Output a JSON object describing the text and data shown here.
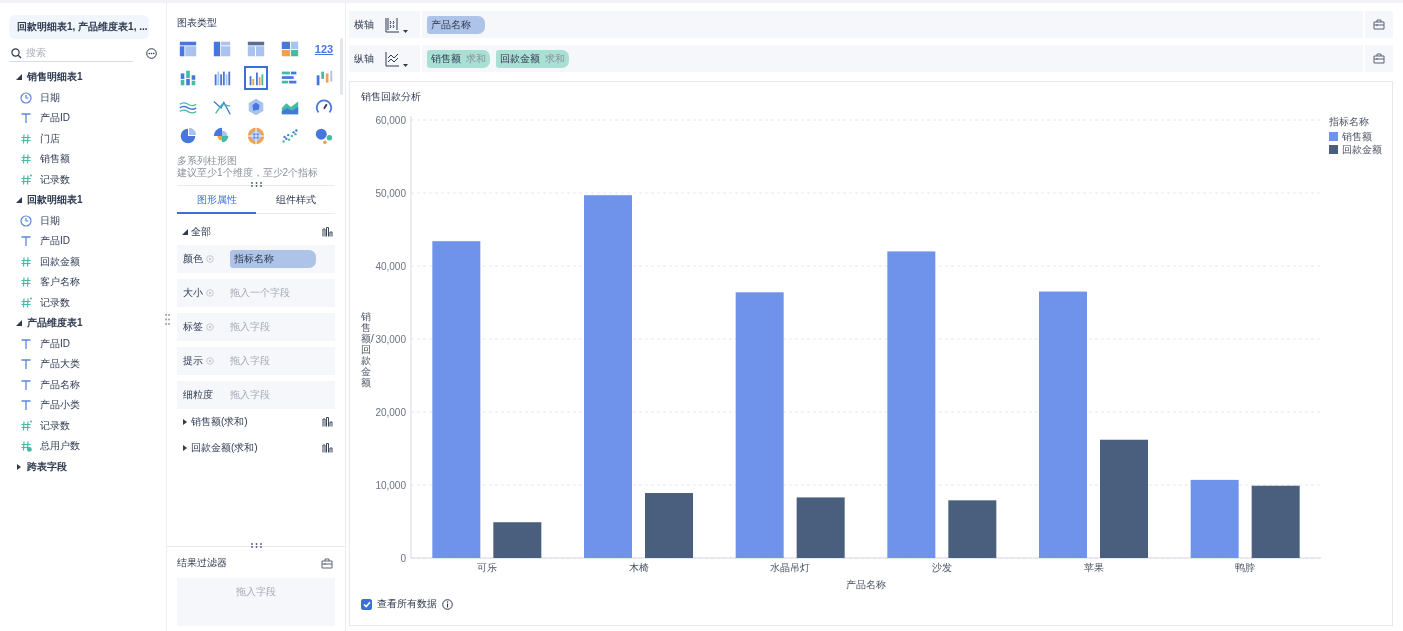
{
  "data_source": {
    "label": "回款明细表1, 产品维度表1, ..."
  },
  "search": {
    "placeholder": "搜索"
  },
  "field_tree": [
    {
      "label": "销售明细表1",
      "expanded": true,
      "children": [
        {
          "label": "日期",
          "kind": "date"
        },
        {
          "label": "产品ID",
          "kind": "text"
        },
        {
          "label": "门店",
          "kind": "number"
        },
        {
          "label": "销售额",
          "kind": "number"
        },
        {
          "label": "记录数",
          "kind": "count"
        }
      ]
    },
    {
      "label": "回款明细表1",
      "expanded": true,
      "children": [
        {
          "label": "日期",
          "kind": "date"
        },
        {
          "label": "产品ID",
          "kind": "text"
        },
        {
          "label": "回款金额",
          "kind": "number"
        },
        {
          "label": "客户名称",
          "kind": "number"
        },
        {
          "label": "记录数",
          "kind": "count"
        }
      ]
    },
    {
      "label": "产品维度表1",
      "expanded": true,
      "children": [
        {
          "label": "产品ID",
          "kind": "text"
        },
        {
          "label": "产品大类",
          "kind": "text"
        },
        {
          "label": "产品名称",
          "kind": "text"
        },
        {
          "label": "产品小类",
          "kind": "text"
        },
        {
          "label": "记录数",
          "kind": "count"
        },
        {
          "label": "总用户数",
          "kind": "calculated"
        }
      ]
    },
    {
      "label": "跨表字段",
      "expanded": false
    }
  ],
  "chart_types": {
    "title": "图表类型",
    "items": [
      {
        "kind": "table",
        "selected": false
      },
      {
        "kind": "crosstab",
        "selected": false
      },
      {
        "kind": "detail",
        "selected": false
      },
      {
        "kind": "treemap",
        "selected": false
      },
      {
        "kind": "number",
        "label": "123",
        "selected": false
      },
      {
        "kind": "stacked",
        "selected": false
      },
      {
        "kind": "columns",
        "selected": false
      },
      {
        "kind": "grouped",
        "selected": true
      },
      {
        "kind": "hbar",
        "selected": false
      },
      {
        "kind": "range",
        "selected": false
      },
      {
        "kind": "wave",
        "selected": false
      },
      {
        "kind": "cross",
        "selected": false
      },
      {
        "kind": "radar",
        "selected": false
      },
      {
        "kind": "area",
        "selected": false
      },
      {
        "kind": "gauge",
        "selected": false
      },
      {
        "kind": "pie",
        "selected": false
      },
      {
        "kind": "rose",
        "selected": false
      },
      {
        "kind": "sunburst",
        "selected": false
      },
      {
        "kind": "scatter",
        "selected": false
      },
      {
        "kind": "bubble",
        "selected": false
      }
    ],
    "description": "多系列柱形图",
    "hint": "建议至少1个维度，至少2个指标"
  },
  "property_tabs": [
    {
      "label": "图形属性",
      "selected": true
    },
    {
      "label": "组件样式",
      "selected": false
    }
  ],
  "properties": {
    "section": {
      "label": "全部",
      "expanded": true
    },
    "rows": [
      {
        "label": "颜色",
        "help": true,
        "value": "指标名称"
      },
      {
        "label": "大小",
        "help": true,
        "placeholder": "拖入一个字段"
      },
      {
        "label": "标签",
        "help": true,
        "placeholder": "拖入字段"
      },
      {
        "label": "提示",
        "help": true,
        "placeholder": "拖入字段"
      },
      {
        "label": "细粒度",
        "help": false,
        "placeholder": "拖入字段"
      }
    ],
    "measures": [
      {
        "label": "销售额(求和)",
        "expanded": false
      },
      {
        "label": "回款金额(求和)",
        "expanded": false
      }
    ]
  },
  "result_filter": {
    "title": "结果过滤器",
    "placeholder": "拖入字段"
  },
  "axes": [
    {
      "label": "横轴",
      "kind": "x",
      "fields": [
        {
          "name": "产品名称",
          "kind": "dimension"
        }
      ]
    },
    {
      "label": "纵轴",
      "kind": "y",
      "fields": [
        {
          "name": "销售额",
          "aggregation": "求和",
          "kind": "measure"
        },
        {
          "name": "回款金额",
          "aggregation": "求和",
          "kind": "measure"
        }
      ]
    }
  ],
  "chart": {
    "title": "销售回款分析",
    "chart_data": {
      "type": "bar",
      "xlabel": "产品名称",
      "ylabel": "销售额/回款金额",
      "categories": [
        "可乐",
        "木椅",
        "水晶吊灯",
        "沙发",
        "苹果",
        "鸭脖"
      ],
      "series": [
        {
          "name": "销售额",
          "color": "#6f93ea",
          "values": [
            43400,
            49700,
            36400,
            42000,
            36500,
            10700
          ]
        },
        {
          "name": "回款金额",
          "color": "#4a5e7e",
          "values": [
            4900,
            8900,
            8300,
            7900,
            16200,
            9900
          ]
        }
      ],
      "ylim": [
        0,
        60000
      ],
      "grid": true,
      "legend": {
        "title": "指标名称"
      },
      "yticks": [
        {
          "value": 0,
          "label": "0"
        },
        {
          "value": 10000,
          "label": "10,000"
        },
        {
          "value": 20000,
          "label": "20,000"
        },
        {
          "value": 30000,
          "label": "30,000"
        },
        {
          "value": 40000,
          "label": "40,000"
        },
        {
          "value": 50000,
          "label": "50,000"
        },
        {
          "value": 60000,
          "label": "60,000"
        }
      ]
    },
    "show_all_data": {
      "label": "查看所有数据",
      "checked": true
    }
  }
}
